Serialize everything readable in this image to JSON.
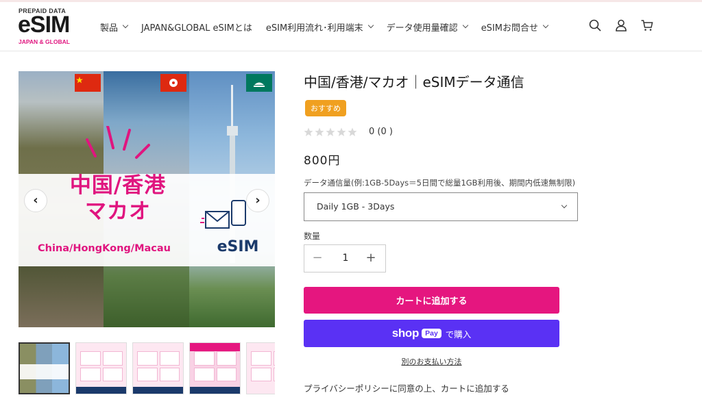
{
  "logo": {
    "top": "PREPAID DATA",
    "main": "eSIM",
    "sub": "JAPAN & GLOBAL"
  },
  "nav": [
    {
      "label": "製品",
      "has_dropdown": true
    },
    {
      "label": "JAPAN&GLOBAL eSIMとは",
      "has_dropdown": false
    },
    {
      "label": "eSIM利用流れ･利用端末",
      "has_dropdown": true
    },
    {
      "label": "データ使用量確認",
      "has_dropdown": true
    },
    {
      "label": "eSIMお問合せ",
      "has_dropdown": true
    }
  ],
  "header_icons": [
    "search-icon",
    "account-icon",
    "cart-icon"
  ],
  "gallery": {
    "title_line1": "中国/香港",
    "title_line2": "マカオ",
    "caption": "China/HongKong/Macau",
    "esim_label": "eSIM",
    "thumb_count": 5
  },
  "product": {
    "title": "中国/香港/マカオ｜eSIMデータ通信",
    "badge": "おすすめ",
    "rating_text": "0 (0 )",
    "stars": 0,
    "price": "800円",
    "variant_label": "データ通信量(例:1GB-5Days＝5日間で総量1GB利用後、期間内低速無制限)",
    "variant_value": "Daily 1GB - 3Days",
    "qty_label": "数量",
    "qty_value": "1",
    "qty_minus": "−",
    "qty_plus": "+",
    "add_to_cart": "カートに追加する",
    "shop_word": "shop",
    "shop_pay": "Pay",
    "buy_now": "で購入",
    "alt_payment": "別のお支払い方法",
    "privacy_note": "プライバシーポリシーに同意の上、カートに追加する"
  },
  "colors": {
    "brand_pink": "#e5167f",
    "shop_purple": "#5a31f4",
    "badge_orange": "#f0a020"
  }
}
